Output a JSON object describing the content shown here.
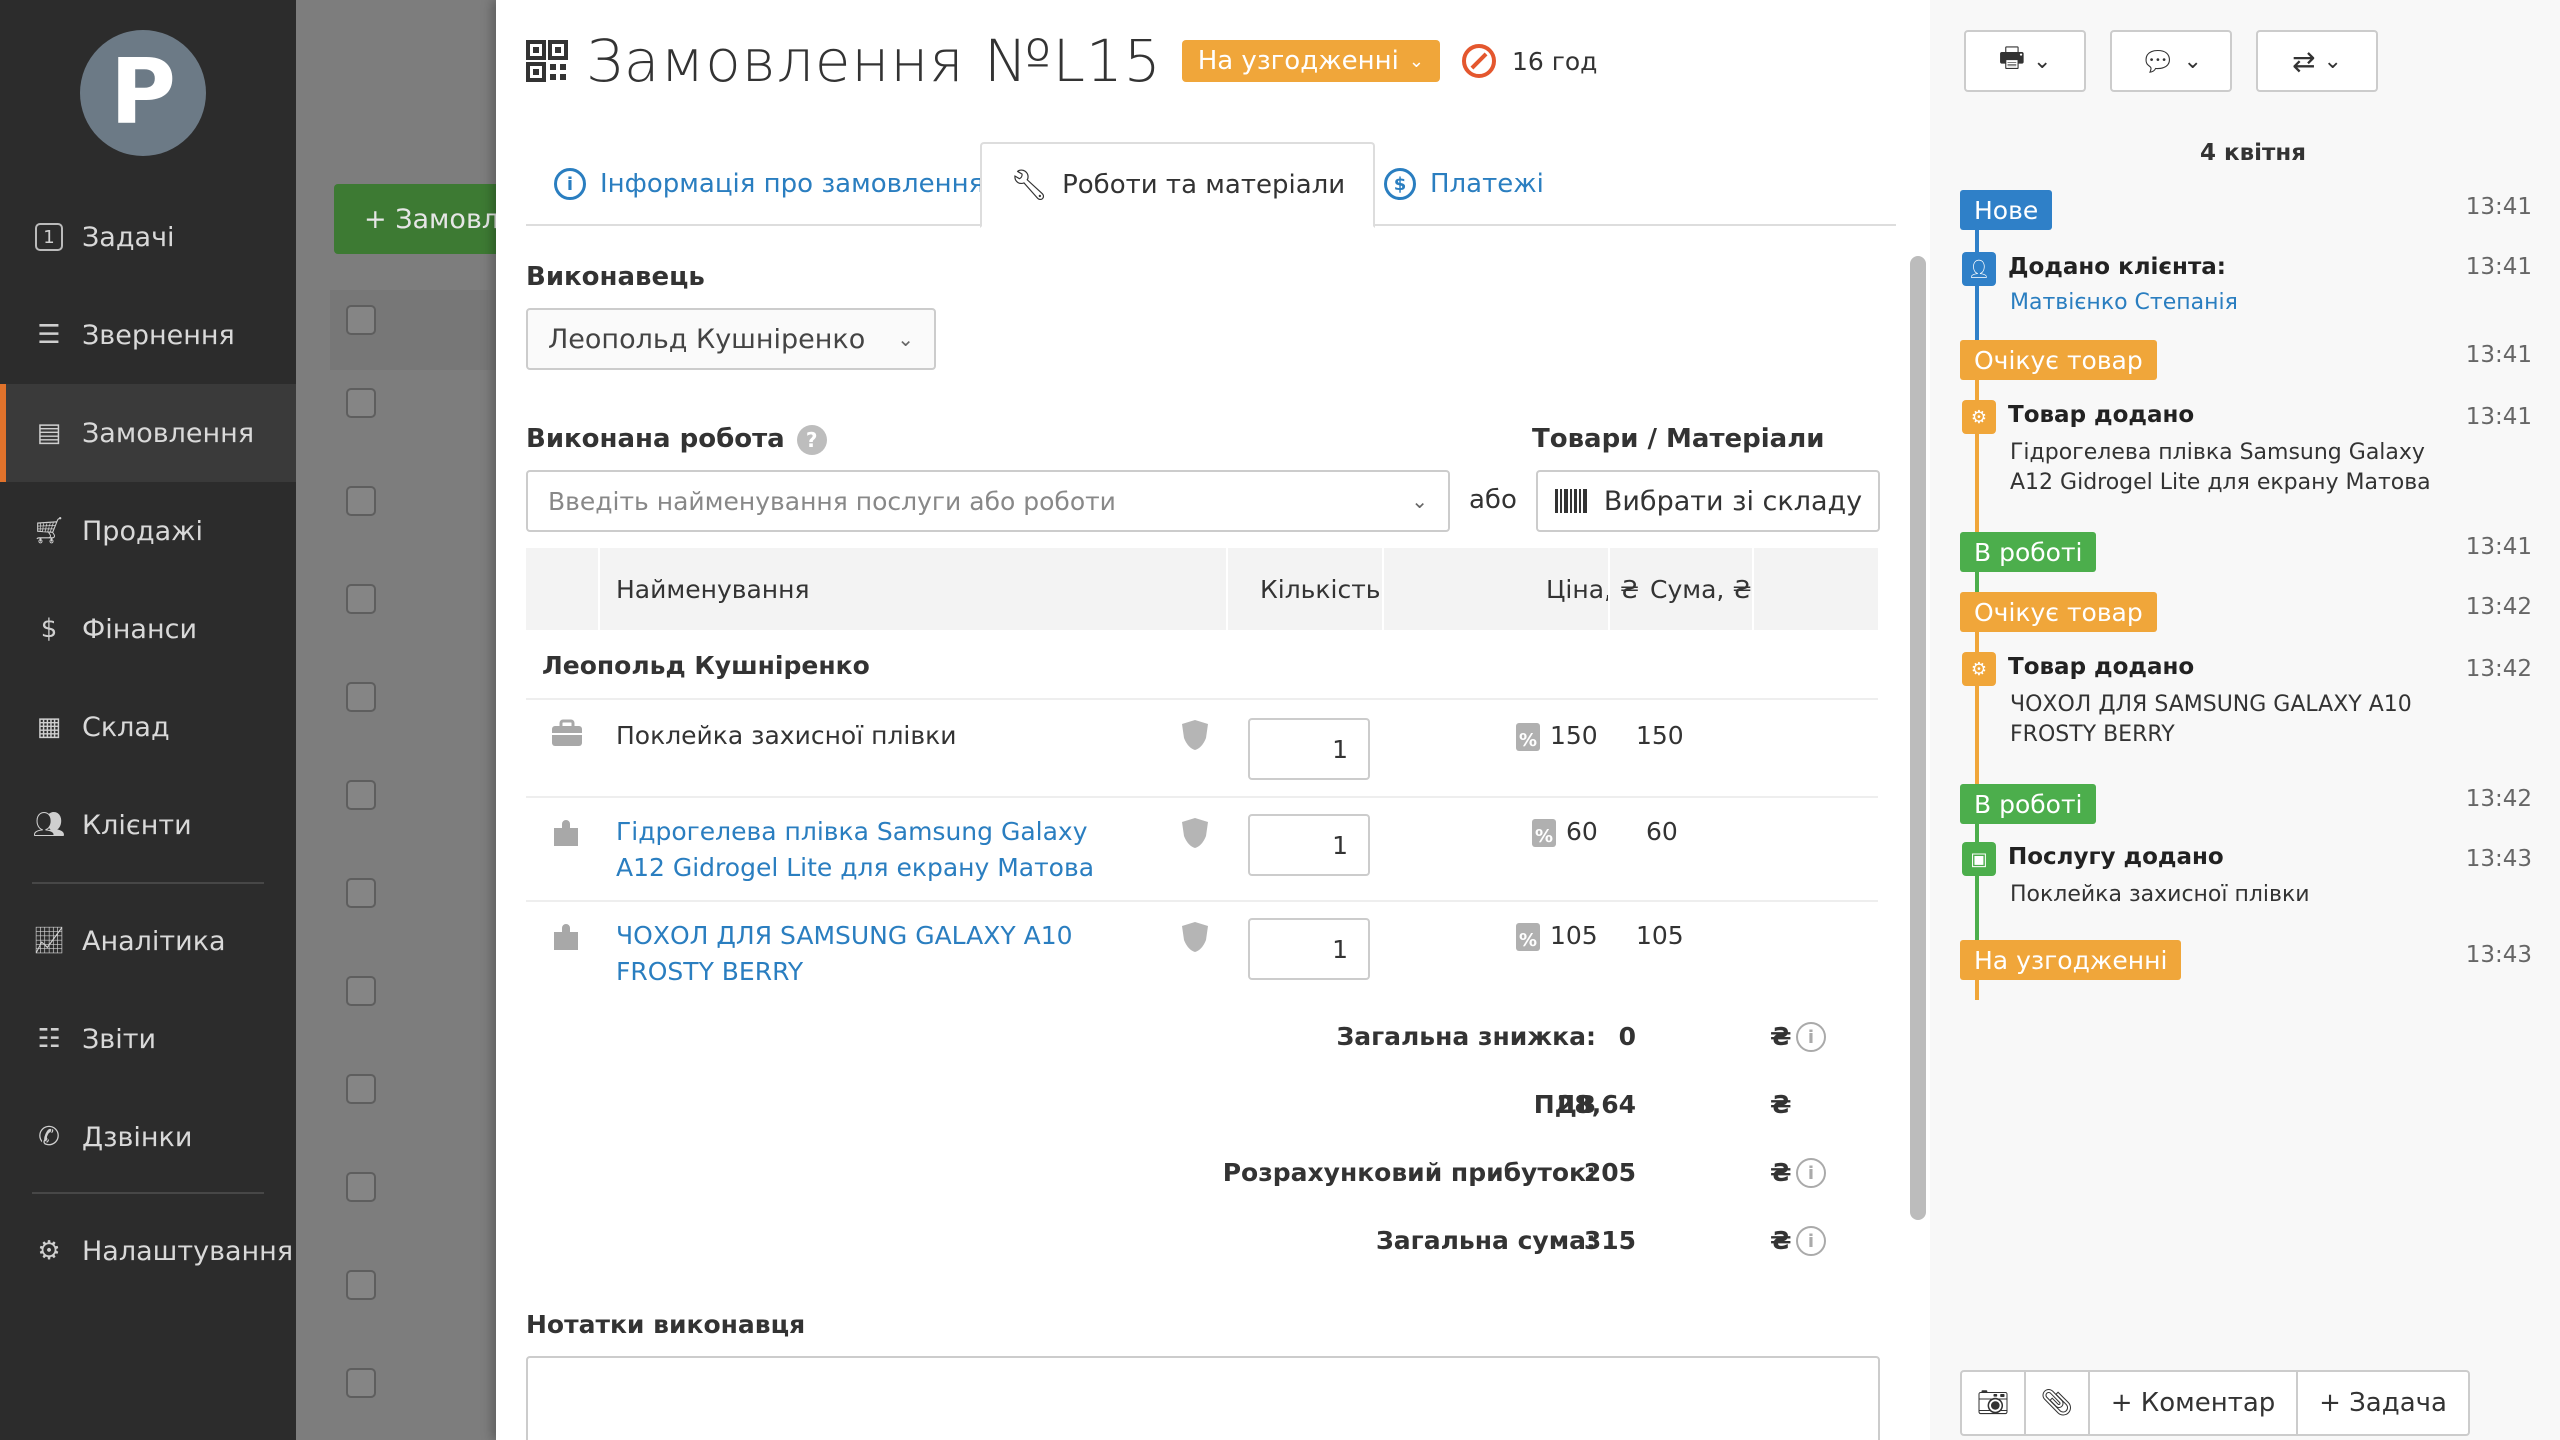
{
  "sidebar": {
    "items": [
      {
        "label": "Задачі",
        "icon": "task-number-icon",
        "badge": "1"
      },
      {
        "label": "Звернення",
        "icon": "filter-icon"
      },
      {
        "label": "Замовлення",
        "icon": "orders-icon"
      },
      {
        "label": "Продажі",
        "icon": "cart-icon"
      },
      {
        "label": "Фінанси",
        "icon": "dollar-icon"
      },
      {
        "label": "Склад",
        "icon": "warehouse-icon"
      },
      {
        "label": "Клієнти",
        "icon": "clients-icon"
      },
      {
        "label": "Аналітика",
        "icon": "analytics-icon"
      },
      {
        "label": "Звіти",
        "icon": "reports-icon"
      },
      {
        "label": "Дзвінки",
        "icon": "phone-icon"
      },
      {
        "label": "Налаштування",
        "icon": "gear-icon"
      }
    ]
  },
  "background": {
    "add_button": "+ Замовл"
  },
  "order": {
    "title": "Замовлення №L15",
    "status": "На узгодженні",
    "deadline": "16 год"
  },
  "tabs": [
    {
      "label": "Інформація про замовлення"
    },
    {
      "label": "Роботи та матеріали"
    },
    {
      "label": "Платежі"
    }
  ],
  "form": {
    "executor_label": "Виконавець",
    "executor_value": "Леопольд Кушніренко",
    "work_label": "Виконана робота",
    "work_placeholder": "Введіть найменування послуги або роботи",
    "or_label": "або",
    "goods_label": "Товари / Матеріали",
    "stock_button": "Вибрати зі складу"
  },
  "table": {
    "headers": {
      "name": "Найменування",
      "qty": "Кількість",
      "price": "Ціна, ₴",
      "sum": "Сума, ₴"
    },
    "group": "Леопольд Кушніренко",
    "rows": [
      {
        "name": "Поклейка захисної плівки",
        "qty": "1",
        "price": "150",
        "sum": "150",
        "type": "service"
      },
      {
        "name": "Гідрогелева плівка Samsung Galaxy A12 Gidrogel Lite для екрану Матова",
        "qty": "1",
        "price": "60",
        "sum": "60",
        "type": "product"
      },
      {
        "name": "ЧОХОЛ ДЛЯ SAMSUNG GALAXY A10 FROSTY BERRY",
        "qty": "1",
        "price": "105",
        "sum": "105",
        "type": "product"
      }
    ]
  },
  "summary": {
    "discount_label": "Загальна знижка:",
    "discount_value": "0",
    "vat_label": "ПДВ",
    "vat_value": "28,64",
    "profit_label": "Розрахунковий прибуток:",
    "profit_value": "205",
    "total_label": "Загальна сума:",
    "total_value": "315",
    "currency": "₴"
  },
  "notes_label": "Нотатки виконавця",
  "timeline": {
    "date": "4 квітня",
    "events": [
      {
        "kind": "status",
        "label": "Нове",
        "time": "13:41",
        "color": "#2f80c8"
      },
      {
        "kind": "event",
        "title": "Додано клієнта:",
        "text": "Матвієнко Степанія",
        "time": "13:41",
        "icon": "client-icon"
      },
      {
        "kind": "status",
        "label": "Очікує товар",
        "time": "13:41",
        "color": "#f0a63a"
      },
      {
        "kind": "event",
        "title": "Товар додано",
        "text": "Гідрогелева плівка Samsung Galaxy A12 Gidrogel Lite для екрану Матова",
        "time": "13:41",
        "icon": "gear-icon"
      },
      {
        "kind": "status",
        "label": "В роботі",
        "time": "13:41",
        "color": "#4cae4c"
      },
      {
        "kind": "status",
        "label": "Очікує товар",
        "time": "13:42",
        "color": "#f0a63a"
      },
      {
        "kind": "event",
        "title": "Товар додано",
        "text": "ЧОХОЛ ДЛЯ SAMSUNG GALAXY A10 FROSTY BERRY",
        "time": "13:42",
        "icon": "gear-icon"
      },
      {
        "kind": "status",
        "label": "В роботі",
        "time": "13:42",
        "color": "#4cae4c"
      },
      {
        "kind": "event",
        "title": "Послугу додано",
        "text": "Поклейка захисної плівки",
        "time": "13:43",
        "icon": "briefcase-icon"
      },
      {
        "kind": "status",
        "label": "На узгодженні",
        "time": "13:43",
        "color": "#f0a63a"
      }
    ]
  },
  "bottom_bar": {
    "comment": "+ Коментар",
    "task": "+ Задача"
  },
  "colors": {
    "accent_blue": "#2a7ec0",
    "orange": "#f0a63a",
    "green": "#4cae4c",
    "sidebar": "#2c2c2c"
  }
}
